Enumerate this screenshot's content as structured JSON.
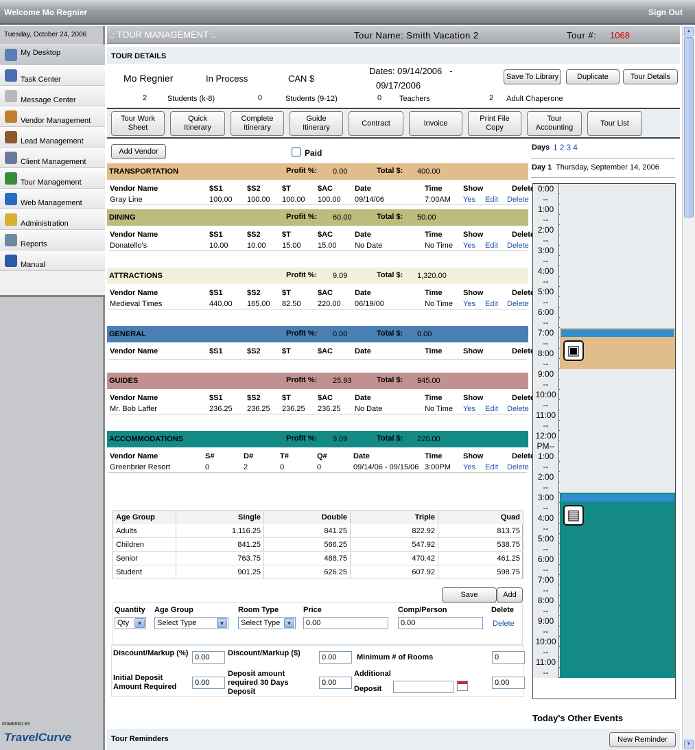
{
  "topbar": {
    "welcome": "Welcome Mo Regnier",
    "signout": "Sign Out"
  },
  "sidebar": {
    "date": "Tuesday, October 24, 2006",
    "items": [
      {
        "label": "My Desktop",
        "icon": "desktop-icon",
        "color": "#5a7fb5"
      },
      {
        "label": "Task Center",
        "icon": "task-icon",
        "color": "#4a6fb0"
      },
      {
        "label": "Message Center",
        "icon": "envelope-icon",
        "color": "#b9b9b9"
      },
      {
        "label": "Vendor Management",
        "icon": "vendor-icon",
        "color": "#c08030"
      },
      {
        "label": "Lead Management",
        "icon": "lead-icon",
        "color": "#8a5a2a"
      },
      {
        "label": "Client Management",
        "icon": "client-icon",
        "color": "#6a7a9a"
      },
      {
        "label": "Tour Management",
        "icon": "globe-icon",
        "color": "#3a8a3a"
      },
      {
        "label": "Web Management",
        "icon": "ie-icon",
        "color": "#2a6ac0"
      },
      {
        "label": "Administration",
        "icon": "lock-icon",
        "color": "#d8b030"
      },
      {
        "label": "Reports",
        "icon": "reports-icon",
        "color": "#6a8aa0"
      },
      {
        "label": "Manual",
        "icon": "help-icon",
        "color": "#2a5aa8"
      }
    ],
    "powered": "POWERED BY",
    "brand": "TravelCurve"
  },
  "header": {
    "section": ".: TOUR MANAGEMENT :.",
    "tour_name": "Tour Name: Smith Vacation 2",
    "tour_no_label": "Tour #:",
    "tour_no": "1068"
  },
  "details": {
    "title": "TOUR DETAILS",
    "agent": "Mo Regnier",
    "status": "In Process",
    "currency": "CAN $",
    "dates1": "Dates: 09/14/2006   -",
    "dates2": "09/17/2006",
    "buttons": {
      "save": "Save To Library",
      "dup": "Duplicate",
      "details": "Tour Details"
    },
    "students_k8_n": "2",
    "students_k8": "Students (k-8)",
    "students_912_n": "0",
    "students_912": "Students (9-12)",
    "teachers_n": "0",
    "teachers": "Teachers",
    "chaperone_n": "2",
    "chaperone": "Adult Chaperone"
  },
  "tabs": [
    {
      "l1": "Tour Work",
      "l2": "Sheet"
    },
    {
      "l1": "Quick",
      "l2": "Itinerary"
    },
    {
      "l1": "Complete",
      "l2": "Itinerary"
    },
    {
      "l1": "Guide",
      "l2": "Itinerary"
    },
    {
      "l1": "Contract",
      "l2": ""
    },
    {
      "l1": "Invoice",
      "l2": ""
    },
    {
      "l1": "Print File",
      "l2": "Copy"
    },
    {
      "l1": "Tour",
      "l2": "Accounting"
    },
    {
      "l1": "Tour List",
      "l2": ""
    }
  ],
  "addvendor": "Add Vendor",
  "paid": "Paid",
  "sections": [
    {
      "name": "TRANSPORTATION",
      "color": "#e2bd8c",
      "profit_label": "Profit %:",
      "profit": "0.00",
      "total_label": "Total $:",
      "total": "400.00",
      "headers": [
        "Vendor Name",
        "$S1",
        "$S2",
        "$T",
        "$AC",
        "Date",
        "Time",
        "Show",
        "Delete"
      ],
      "rows": [
        [
          "Gray Line",
          "100.00",
          "100.00",
          "100.00",
          "100.00",
          "09/14/06",
          "7:00AM",
          "Yes",
          "Edit",
          "Delete"
        ]
      ]
    },
    {
      "name": "DINING",
      "color": "#bfbb7c",
      "profit_label": "Profit %:",
      "profit": "60.00",
      "total_label": "Total $:",
      "total": "50.00",
      "headers": [
        "Vendor Name",
        "$S1",
        "$S2",
        "$T",
        "$AC",
        "Date",
        "Time",
        "Show",
        "Delete"
      ],
      "rows": [
        [
          "Donatello's",
          "10.00",
          "10.00",
          "15.00",
          "15.00",
          "No Date",
          "No Time",
          "Yes",
          "Edit",
          "Delete"
        ]
      ]
    },
    {
      "name": "ATTRACTIONS",
      "color": "#f3f1dc",
      "profit_label": "Profit %:",
      "profit": "9.09",
      "total_label": "Total $:",
      "total": "1,320.00",
      "headers": [
        "Vendor Name",
        "$S1",
        "$S2",
        "$T",
        "$AC",
        "Date",
        "Time",
        "Show",
        "Delete"
      ],
      "rows": [
        [
          "Medieval Times",
          "440.00",
          "165.00",
          "82.50",
          "220.00",
          "06/19/00",
          "No Time",
          "Yes",
          "Edit",
          "Delete"
        ]
      ]
    },
    {
      "name": "GENERAL",
      "color": "#4a7fb5",
      "profit_label": "Profit %:",
      "profit": "0.00",
      "total_label": "Total $:",
      "total": "0.00",
      "headers": [
        "Vendor Name",
        "$S1",
        "$S2",
        "$T",
        "$AC",
        "Date",
        "Time",
        "Show",
        "Delete"
      ],
      "rows": []
    },
    {
      "name": "GUIDES",
      "color": "#c19190",
      "profit_label": "Profit %:",
      "profit": "25.93",
      "total_label": "Total $:",
      "total": "945.00",
      "headers": [
        "Vendor Name",
        "$S1",
        "$S2",
        "$T",
        "$AC",
        "Date",
        "Time",
        "Show",
        "Delete"
      ],
      "rows": [
        [
          "Mr. Bob Laffer",
          "236.25",
          "236.25",
          "236.25",
          "236.25",
          "No Date",
          "No Time",
          "Yes",
          "Edit",
          "Delete"
        ]
      ]
    },
    {
      "name": "ACCOMMODATIONS",
      "color": "#148a86",
      "profit_label": "Profit %:",
      "profit": "9.09",
      "total_label": "Total $:",
      "total": "220.00",
      "headers": [
        "Vendor Name",
        "S#",
        "D#",
        "T#",
        "Q#",
        "Date",
        "Time",
        "Show",
        "Delete"
      ],
      "rows": [
        [
          "Greenbrier Resort",
          "0",
          "2",
          "0",
          "0",
          "09/14/06 - 09/15/06",
          "3:00PM",
          "Yes",
          "Edit",
          "Delete"
        ]
      ]
    }
  ],
  "agegroups": {
    "headers": [
      "Age Group",
      "Single",
      "Double",
      "Triple",
      "Quad"
    ],
    "rows": [
      [
        "Adults",
        "1,116.25",
        "841.25",
        "822.92",
        "813.75"
      ],
      [
        "Children",
        "841.25",
        "566.25",
        "547.92",
        "538.75"
      ],
      [
        "Senior",
        "763.75",
        "488.75",
        "470.42",
        "461.25"
      ],
      [
        "Student",
        "901.25",
        "626.25",
        "607.92",
        "598.75"
      ]
    ],
    "save": "Save",
    "add": "Add"
  },
  "roomform": {
    "headers": [
      "Quantity",
      "Age Group",
      "Room Type",
      "Price",
      "Comp/Person",
      "Delete"
    ],
    "qty": "Qty",
    "agegroup": "Select Type",
    "roomtype": "Select Type",
    "price": "0.00",
    "comp": "0.00",
    "delete": "Delete"
  },
  "discounts": {
    "pct_label": "Discount/Markup (%)",
    "pct": "0.00",
    "amt_label": "Discount/Markup ($)",
    "amt": "0.00",
    "minrooms_label": "Minimum # of Rooms",
    "minrooms": "0",
    "initdep_label": "Initial Deposit Amount Required",
    "initdep": "0.00",
    "dep30_label": "Deposit amount required 30 Days Deposit",
    "dep30": "0.00",
    "add_label1": "Additional",
    "add_label2": "Deposit",
    "adddate": "",
    "adddep": "0.00"
  },
  "reminders": {
    "title": "Tour Reminders",
    "button": "New Reminder"
  },
  "calendar": {
    "days_label": "Days",
    "days": [
      "1",
      "2",
      "3",
      "4"
    ],
    "day_title": "Day 1",
    "day_date": "Thursday, September 14, 2006",
    "slots": [
      "0:00",
      "--",
      "1:00",
      "--",
      "2:00",
      "--",
      "3:00",
      "--",
      "4:00",
      "--",
      "5:00",
      "--",
      "6:00",
      "--",
      "7:00",
      "--",
      "8:00",
      "--",
      "9:00",
      "--",
      "10:00",
      "--",
      "11:00",
      "--",
      "12:00",
      "PM--",
      "1:00",
      "--",
      "2:00",
      "--",
      "3:00",
      "--",
      "4:00",
      "--",
      "5:00",
      "--",
      "6:00",
      "--",
      "7:00",
      "--",
      "8:00",
      "--",
      "9:00",
      "--",
      "10:00",
      "--",
      "11:00",
      "--"
    ],
    "events": [
      {
        "name": "transportation",
        "start": 14,
        "slots": 4,
        "color": "#e2bd8c",
        "icon": "bus-icon"
      },
      {
        "name": "accommodations",
        "start": 30,
        "slots": 18,
        "color": "#148a86",
        "icon": "bed-icon"
      }
    ],
    "other_events": "Today's Other Events"
  }
}
